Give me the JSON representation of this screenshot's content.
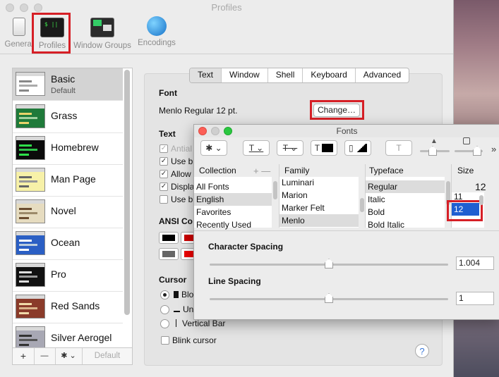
{
  "window": {
    "title": "Profiles"
  },
  "toolbar": {
    "items": [
      {
        "label": "General"
      },
      {
        "label": "Profiles"
      },
      {
        "label": "Window Groups"
      },
      {
        "label": "Encodings"
      }
    ]
  },
  "sidebar": {
    "profiles": [
      {
        "name": "Basic",
        "sub": "Default"
      },
      {
        "name": "Grass"
      },
      {
        "name": "Homebrew"
      },
      {
        "name": "Man Page"
      },
      {
        "name": "Novel"
      },
      {
        "name": "Ocean"
      },
      {
        "name": "Pro"
      },
      {
        "name": "Red Sands"
      },
      {
        "name": "Silver Aerogel"
      }
    ],
    "footer": {
      "add": "+",
      "remove": "—",
      "gear": "✱ ⌄",
      "default": "Default"
    }
  },
  "tabs": [
    "Text",
    "Window",
    "Shell",
    "Keyboard",
    "Advanced"
  ],
  "text_tab": {
    "font_heading": "Font",
    "font_value": "Menlo Regular 12 pt.",
    "change_button": "Change…",
    "text_heading": "Text",
    "checkboxes": [
      "Antial",
      "Use b",
      "Allow",
      "Displa",
      "Use b"
    ],
    "ansi_heading": "ANSI Co",
    "cursor_heading": "Cursor",
    "cursor_options": [
      "Blo",
      "Un",
      "Vertical Bar"
    ],
    "blink_label": "Blink cursor",
    "help": "?"
  },
  "fonts_panel": {
    "title": "Fonts",
    "columns": {
      "collection": "Collection",
      "family": "Family",
      "typeface": "Typeface",
      "size": "Size"
    },
    "collection_controls": "+ —",
    "collections": [
      "All Fonts",
      "English",
      "Favorites",
      "Recently Used"
    ],
    "families": [
      "Luminari",
      "Marion",
      "Marker Felt",
      "Menlo"
    ],
    "typefaces": [
      "Regular",
      "Italic",
      "Bold",
      "Bold Italic"
    ],
    "size_value": "12",
    "sizes": [
      "11",
      "12"
    ],
    "char_spacing_label": "Character Spacing",
    "char_spacing_value": "1.004",
    "line_spacing_label": "Line Spacing",
    "line_spacing_value": "1",
    "char_spacing_level": 0.5,
    "line_spacing_level": 0.5
  },
  "colors": {
    "highlight_red": "#d61f26",
    "selection_blue": "#1f5fd1"
  }
}
